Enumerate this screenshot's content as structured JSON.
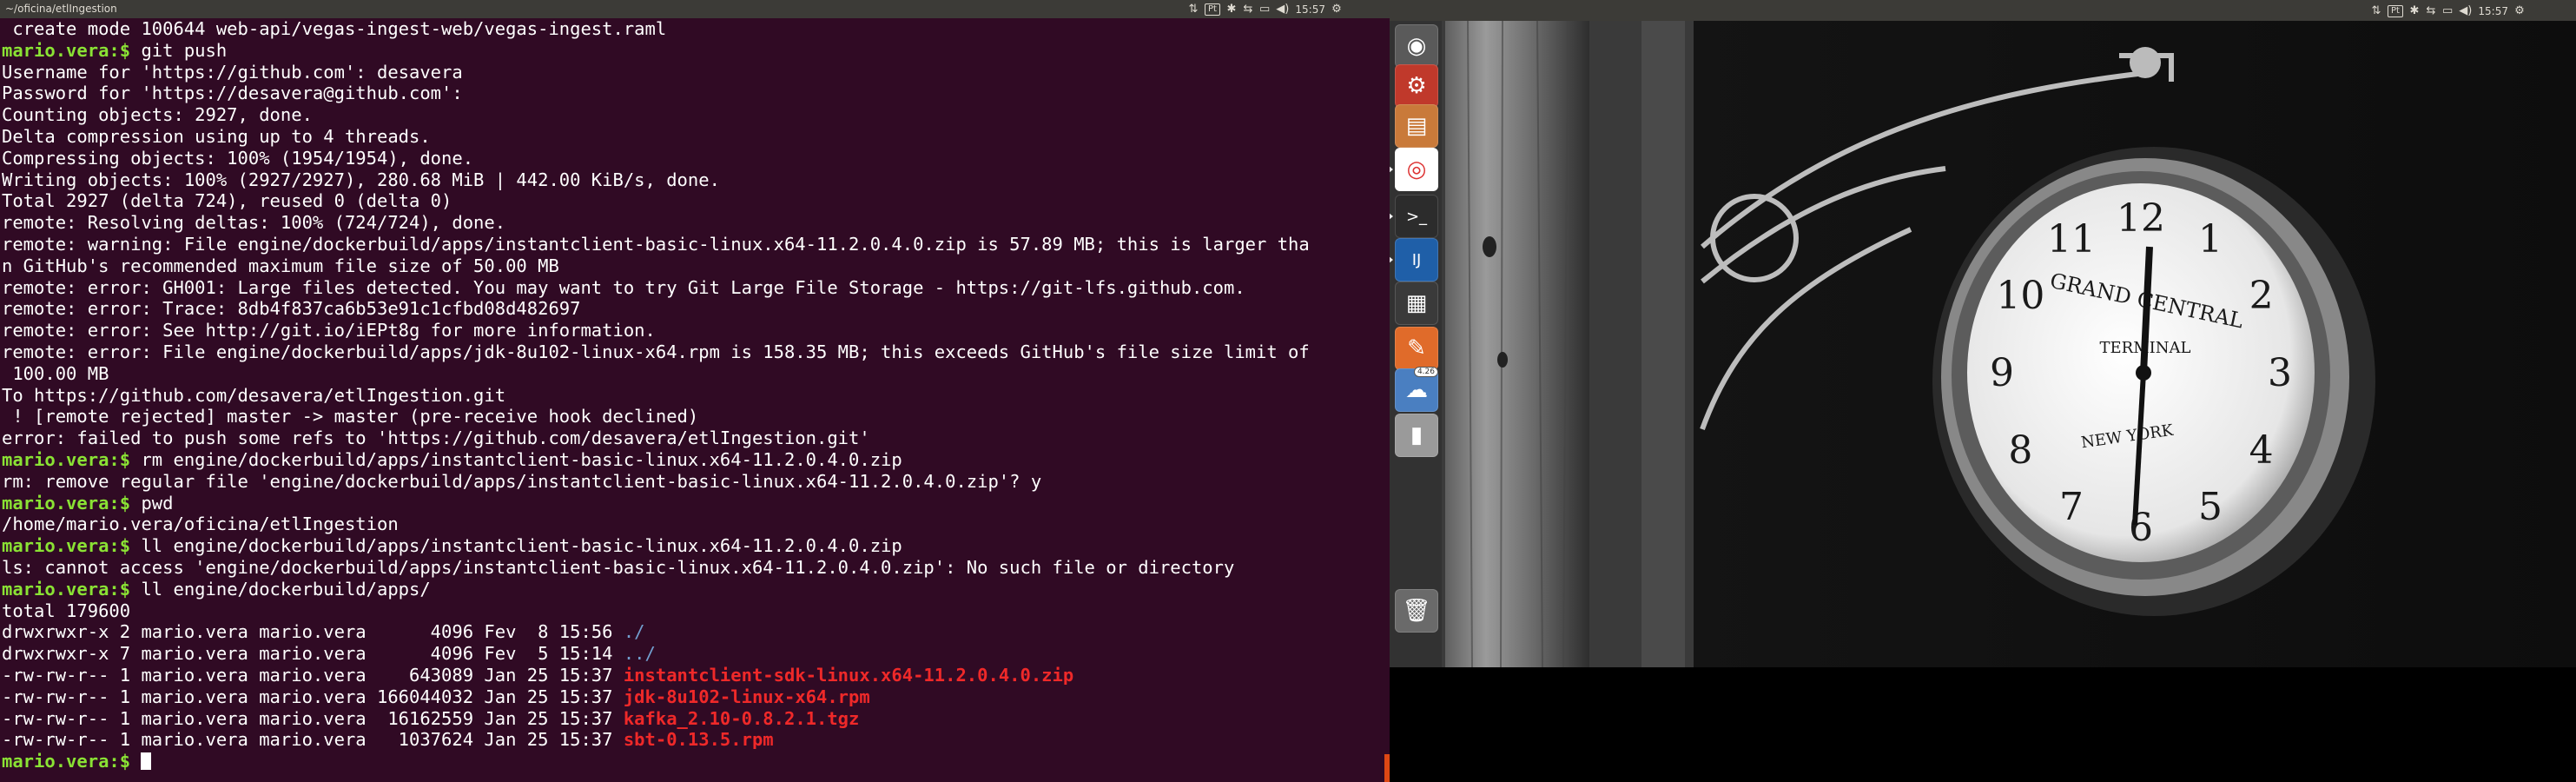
{
  "left_topbar": {
    "title": "~/oficina/etlIngestion",
    "indicators": [
      "transfer-icon",
      "keyboard-icon",
      "bluetooth-icon",
      "network-icon",
      "battery-icon",
      "volume-icon"
    ],
    "keyboard_label": "Pt",
    "clock": "15:57"
  },
  "right_topbar": {
    "keyboard_label": "Pt",
    "clock": "15:57"
  },
  "terminal": {
    "prompt": "mario.vera:$",
    "lines": [
      {
        "type": "plain",
        "text": " create mode 100644 web-api/vegas-ingest-web/vegas-ingest.raml"
      },
      {
        "type": "cmd",
        "text": " git push"
      },
      {
        "type": "plain",
        "text": "Username for 'https://github.com': desavera"
      },
      {
        "type": "plain",
        "text": "Password for 'https://desavera@github.com':"
      },
      {
        "type": "plain",
        "text": "Counting objects: 2927, done."
      },
      {
        "type": "plain",
        "text": "Delta compression using up to 4 threads."
      },
      {
        "type": "plain",
        "text": "Compressing objects: 100% (1954/1954), done."
      },
      {
        "type": "plain",
        "text": "Writing objects: 100% (2927/2927), 280.68 MiB | 442.00 KiB/s, done."
      },
      {
        "type": "plain",
        "text": "Total 2927 (delta 724), reused 0 (delta 0)"
      },
      {
        "type": "plain",
        "text": "remote: Resolving deltas: 100% (724/724), done."
      },
      {
        "type": "plain",
        "text": "remote: warning: File engine/dockerbuild/apps/instantclient-basic-linux.x64-11.2.0.4.0.zip is 57.89 MB; this is larger tha"
      },
      {
        "type": "plain",
        "text": "n GitHub's recommended maximum file size of 50.00 MB"
      },
      {
        "type": "plain",
        "text": "remote: error: GH001: Large files detected. You may want to try Git Large File Storage - https://git-lfs.github.com."
      },
      {
        "type": "plain",
        "text": "remote: error: Trace: 8db4f837ca6b53e91c1cfbd08d482697"
      },
      {
        "type": "plain",
        "text": "remote: error: See http://git.io/iEPt8g for more information."
      },
      {
        "type": "plain",
        "text": "remote: error: File engine/dockerbuild/apps/jdk-8u102-linux-x64.rpm is 158.35 MB; this exceeds GitHub's file size limit of"
      },
      {
        "type": "plain",
        "text": " 100.00 MB"
      },
      {
        "type": "plain",
        "text": "To https://github.com/desavera/etlIngestion.git"
      },
      {
        "type": "plain",
        "text": " ! [remote rejected] master -> master (pre-receive hook declined)"
      },
      {
        "type": "plain",
        "text": "error: failed to push some refs to 'https://github.com/desavera/etlIngestion.git'"
      },
      {
        "type": "cmd",
        "text": " rm engine/dockerbuild/apps/instantclient-basic-linux.x64-11.2.0.4.0.zip"
      },
      {
        "type": "plain",
        "text": "rm: remove regular file 'engine/dockerbuild/apps/instantclient-basic-linux.x64-11.2.0.4.0.zip'? y"
      },
      {
        "type": "cmd",
        "text": " pwd"
      },
      {
        "type": "plain",
        "text": "/home/mario.vera/oficina/etlIngestion"
      },
      {
        "type": "cmd",
        "text": " ll engine/dockerbuild/apps/instantclient-basic-linux.x64-11.2.0.4.0.zip"
      },
      {
        "type": "plain",
        "text": "ls: cannot access 'engine/dockerbuild/apps/instantclient-basic-linux.x64-11.2.0.4.0.zip': No such file or directory"
      },
      {
        "type": "cmd",
        "text": " ll engine/dockerbuild/apps/"
      },
      {
        "type": "plain",
        "text": "total 179600"
      },
      {
        "type": "ls",
        "text": "drwxrwxr-x 2 mario.vera mario.vera      4096 Fev  8 15:56 ",
        "name": "./"
      },
      {
        "type": "ls",
        "text": "drwxrwxr-x 7 mario.vera mario.vera      4096 Fev  5 15:14 ",
        "name": "../"
      },
      {
        "type": "lsred",
        "text": "-rw-rw-r-- 1 mario.vera mario.vera    643089 Jan 25 15:37 ",
        "name": "instantclient-sdk-linux.x64-11.2.0.4.0.zip"
      },
      {
        "type": "lsred",
        "text": "-rw-rw-r-- 1 mario.vera mario.vera 166044032 Jan 25 15:37 ",
        "name": "jdk-8u102-linux-x64.rpm"
      },
      {
        "type": "lsred",
        "text": "-rw-rw-r-- 1 mario.vera mario.vera  16162559 Jan 25 15:37 ",
        "name": "kafka_2.10-0.8.2.1.tgz"
      },
      {
        "type": "lsred",
        "text": "-rw-rw-r-- 1 mario.vera mario.vera   1037624 Jan 25 15:37 ",
        "name": "sbt-0.13.5.rpm"
      },
      {
        "type": "cursor",
        "text": " "
      }
    ]
  },
  "wallpaper": {
    "clock_face_text_top": "GRAND CENTRAL",
    "clock_face_text_mid": "TERMINAL",
    "clock_face_text_bottom": "NEW YORK",
    "clock_numerals": [
      "12",
      "1",
      "2",
      "3",
      "4",
      "5",
      "6",
      "7",
      "8",
      "9",
      "10",
      "11"
    ]
  },
  "launcher": {
    "items": [
      {
        "icon": "ubuntu-dash-icon",
        "glyph": "◉"
      },
      {
        "icon": "system-settings-icon",
        "glyph": "⚙"
      },
      {
        "icon": "file-manager-icon",
        "glyph": "▤"
      },
      {
        "icon": "chrome-icon",
        "glyph": "◎"
      },
      {
        "icon": "terminal-icon",
        "glyph": ">_"
      },
      {
        "icon": "intellij-icon",
        "glyph": "IJ"
      },
      {
        "icon": "calculator-icon",
        "glyph": "▦"
      },
      {
        "icon": "text-editor-icon",
        "glyph": "✎"
      },
      {
        "icon": "cloud-app-icon",
        "glyph": "☁",
        "badge": "4.26"
      },
      {
        "icon": "usb-drive-icon",
        "glyph": "▮"
      },
      {
        "icon": "trash-icon",
        "glyph": "🗑"
      }
    ]
  }
}
